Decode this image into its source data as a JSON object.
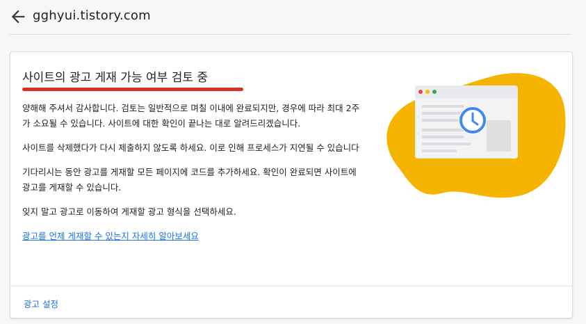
{
  "header": {
    "back_icon": "arrow-back-icon",
    "site_title": "gghyui.tistory.com"
  },
  "card": {
    "title": "사이트의 광고 게재 가능 여부 검토 중",
    "paragraphs": [
      "양해해 주셔서 감사합니다. 검토는 일반적으로 며칠 이내에 완료되지만, 경우에 따라 최대 2주가 소요될 수 있습니다. 사이트에 대한 확인이 끝나는 대로 알려드리겠습니다.",
      "사이트를 삭제했다가 다시 제출하지 않도록 하세요. 이로 인해 프로세스가 지연될 수 있습니다",
      "기다리시는 동안 광고를 게재할 모든 페이지에 코드를 추가하세요. 확인이 완료되면 사이트에 광고를 게재할 수 있습니다.",
      "잊지 말고 광고로 이동하여 게재할 광고 형식을 선택하세요."
    ],
    "learn_more_link": "광고를 언제 게재할 수 있는지 자세히 알아보세요",
    "footer_link": "광고 설정"
  },
  "illustration": {
    "icons": [
      "browser-window-icon",
      "clock-icon"
    ],
    "colors": {
      "blob": "#f4b400",
      "window": "#f1f3f4",
      "clock": "#4285f4",
      "dot_red": "#ea4335",
      "dot_yellow": "#fbbc04",
      "dot_green": "#34a853"
    }
  },
  "colors": {
    "accent_underline": "#d93025",
    "link": "#1a73e8"
  }
}
